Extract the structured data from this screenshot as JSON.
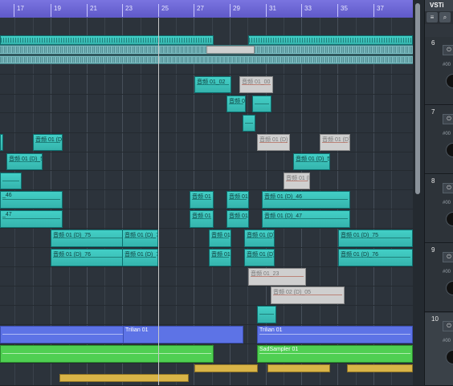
{
  "ruler": {
    "bars": [
      "17",
      "19",
      "21",
      "23",
      "25",
      "27",
      "29",
      "31",
      "33",
      "35",
      "37"
    ]
  },
  "clips": {
    "c1": "音频 01_02",
    "c2": "音频 01_00",
    "c3": "音频 0",
    "c4": "音频 01 (D)",
    "c5": "音频 01 (D)",
    "c6": "音频 01 (D)",
    "c7": "音频 01 (D)_54",
    "c8": "音频 01 (D)_54",
    "c9": "音频 01 (D)",
    "c10": "_46",
    "c11": "音频 01",
    "c12": "音频 01",
    "c13": "音频 01 (D)_46",
    "c14": "_47",
    "c15": "音频 01",
    "c16": "音频 01",
    "c17": "音频 01 (D)_47",
    "c18": "音频 01 (D)_75",
    "c19": "音频 01 (D)_75",
    "c20": "音频 01",
    "c21": "音频 01 (D)",
    "c22": "音频 01 (D)_75",
    "c23": "音频 01 (D)_76",
    "c24": "音频 01 (D)_76",
    "c25": "音频 01",
    "c26": "音频 01 (D)",
    "c27": "音频 01 (D)_76",
    "c28": "音频 01_23",
    "c29": "音频 02 (D)_05",
    "c30": "Trilian 01",
    "c31": "Trilian 01",
    "c32": "SadSampler 01"
  },
  "vsti": {
    "title": "VSTi",
    "tool1": "≡",
    "tool2": "⌕",
    "slots": [
      "6",
      "7",
      "8",
      "9",
      "10"
    ],
    "slot_btn": "⏻",
    "slot_small": "#00"
  }
}
